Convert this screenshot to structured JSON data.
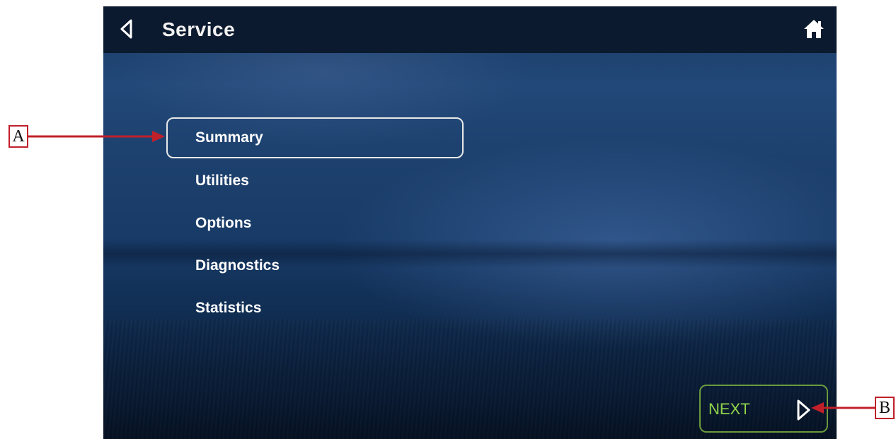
{
  "header": {
    "title": "Service",
    "back_icon": "back-chevron-icon",
    "home_icon": "home-icon"
  },
  "menu": {
    "items": [
      {
        "label": "Summary",
        "selected": true
      },
      {
        "label": "Utilities",
        "selected": false
      },
      {
        "label": "Options",
        "selected": false
      },
      {
        "label": "Diagnostics",
        "selected": false
      },
      {
        "label": "Statistics",
        "selected": false
      }
    ]
  },
  "footer": {
    "next_label": "NEXT",
    "next_icon": "forward-chevron-icon"
  },
  "callouts": {
    "a": "A",
    "b": "B"
  },
  "colors": {
    "header_bg": "#0b1a2e",
    "text": "#ffffff",
    "next_accent": "#8fd34a",
    "next_border": "#6b9a3c",
    "callout_red": "#c0202a"
  }
}
